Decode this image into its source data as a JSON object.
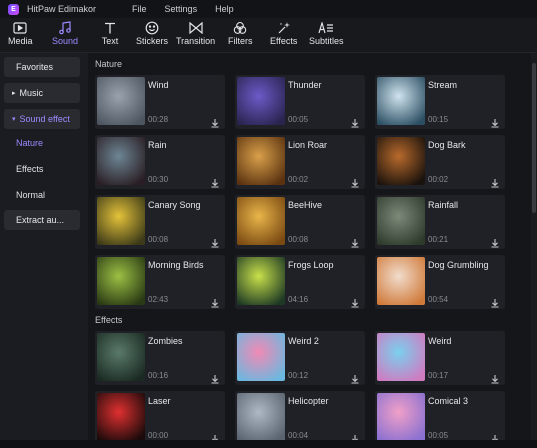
{
  "app": {
    "title": "HitPaw Edimakor",
    "logo_letter": "E"
  },
  "menu": [
    "File",
    "Settings",
    "Help"
  ],
  "toolbar": [
    {
      "label": "Media",
      "icon": "media-icon"
    },
    {
      "label": "Sound",
      "icon": "music-note-icon",
      "active": true
    },
    {
      "label": "Text",
      "icon": "text-icon"
    },
    {
      "label": "Stickers",
      "icon": "smiley-icon"
    },
    {
      "label": "Transition",
      "icon": "transition-icon"
    },
    {
      "label": "Filters",
      "icon": "filters-icon"
    },
    {
      "label": "Effects",
      "icon": "sparkle-icon"
    },
    {
      "label": "Subtitles",
      "icon": "subtitles-icon"
    }
  ],
  "sidebar": {
    "favorites": "Favorites",
    "music": "Music",
    "sound_effect": "Sound effect",
    "sub_items": [
      "Nature",
      "Effects",
      "Normal"
    ],
    "extract": "Extract au..."
  },
  "sections": [
    {
      "title": "Nature",
      "items": [
        {
          "name": "Wind",
          "duration": "00:28",
          "thumb": "wind"
        },
        {
          "name": "Thunder",
          "duration": "00:05",
          "thumb": "thunder"
        },
        {
          "name": "Stream",
          "duration": "00:15",
          "thumb": "stream"
        },
        {
          "name": "Rain",
          "duration": "00:30",
          "thumb": "rain"
        },
        {
          "name": "Lion Roar",
          "duration": "00:02",
          "thumb": "lion"
        },
        {
          "name": "Dog Bark",
          "duration": "00:02",
          "thumb": "dog"
        },
        {
          "name": "Canary Song",
          "duration": "00:08",
          "thumb": "canary"
        },
        {
          "name": "BeeHive",
          "duration": "00:08",
          "thumb": "beehive"
        },
        {
          "name": "Rainfall",
          "duration": "00:21",
          "thumb": "rainfall"
        },
        {
          "name": "Morning Birds",
          "duration": "02:43",
          "thumb": "birds"
        },
        {
          "name": "Frogs Loop",
          "duration": "04:16",
          "thumb": "frog"
        },
        {
          "name": "Dog Grumbling",
          "duration": "00:54",
          "thumb": "puppy"
        }
      ]
    },
    {
      "title": "Effects",
      "items": [
        {
          "name": "Zombies",
          "duration": "00:16",
          "thumb": "zombies"
        },
        {
          "name": "Weird 2",
          "duration": "00:12",
          "thumb": "weird2"
        },
        {
          "name": "Weird",
          "duration": "00:17",
          "thumb": "weird"
        },
        {
          "name": "Laser",
          "duration": "00:00",
          "thumb": "laser"
        },
        {
          "name": "Helicopter",
          "duration": "00:04",
          "thumb": "heli"
        },
        {
          "name": "Comical 3",
          "duration": "00:05",
          "thumb": "comical"
        }
      ]
    }
  ],
  "thumb_colors": {
    "wind": [
      "#9aa3ad",
      "#4d5660"
    ],
    "thunder": [
      "#6c5ac8",
      "#2a2450"
    ],
    "stream": [
      "#cfe3ee",
      "#2c4f63"
    ],
    "rain": [
      "#6d8694",
      "#2a1e24"
    ],
    "lion": [
      "#d9a04a",
      "#5a3210"
    ],
    "dog": [
      "#b86a2c",
      "#1a120c"
    ],
    "canary": [
      "#e4c23a",
      "#3c3a18"
    ],
    "beehive": [
      "#e9b54a",
      "#7a4a12"
    ],
    "rainfall": [
      "#7d8a7a",
      "#2e3a2c"
    ],
    "birds": [
      "#9cc044",
      "#2a3a14"
    ],
    "frog": [
      "#c8e04a",
      "#1e3a24"
    ],
    "puppy": [
      "#f1dccc",
      "#d07a3a"
    ],
    "zombies": [
      "#5a7a6a",
      "#1a2a22"
    ],
    "weird2": [
      "#f08ab4",
      "#6ab8e0"
    ],
    "weird": [
      "#7ad0ee",
      "#d07ac0"
    ],
    "laser": [
      "#e03030",
      "#1a0a0a"
    ],
    "heli": [
      "#aeb9c4",
      "#5a6470"
    ],
    "comical": [
      "#f0a0c8",
      "#8a70d0"
    ]
  },
  "accent": "#9b8cff"
}
